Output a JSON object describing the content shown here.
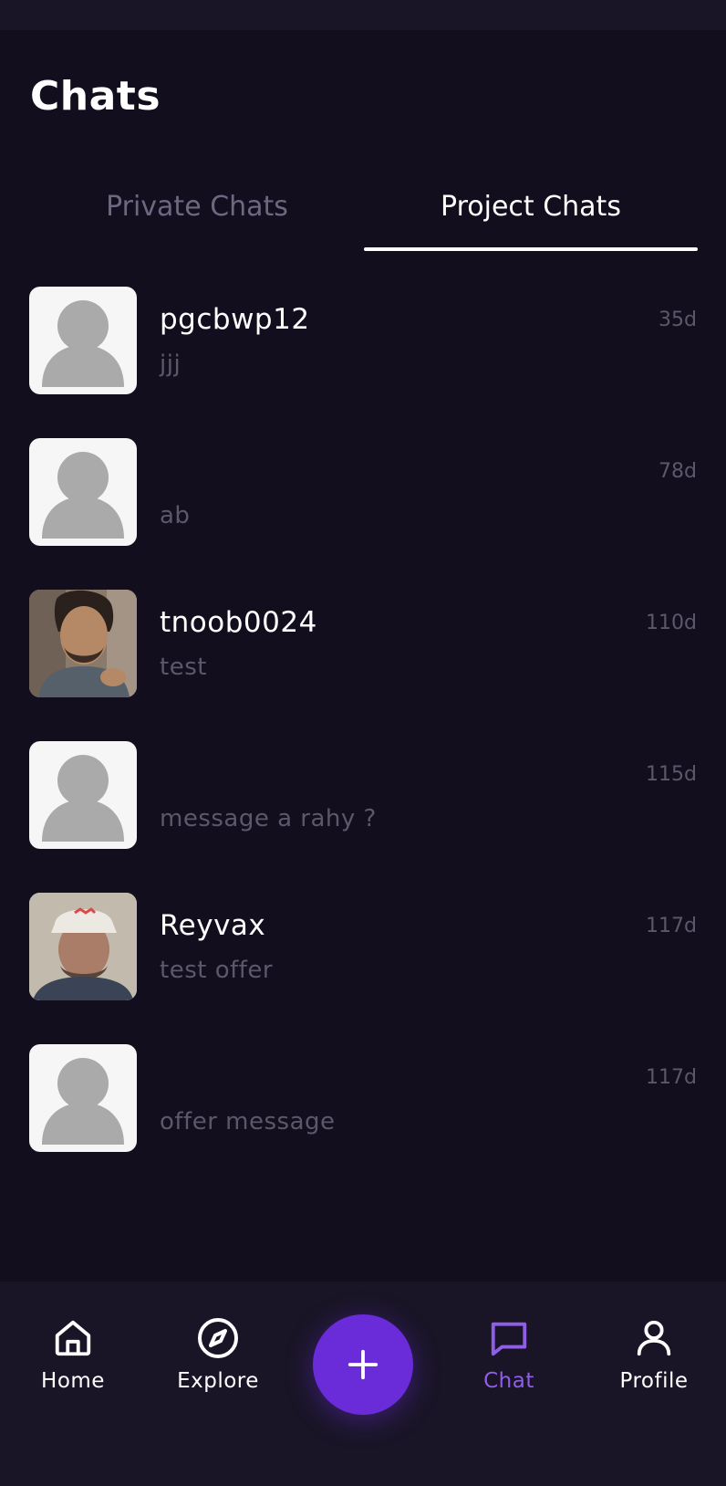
{
  "header": {
    "title": "Chats"
  },
  "tabs": [
    {
      "label": "Private Chats",
      "active": false
    },
    {
      "label": "Project Chats",
      "active": true
    }
  ],
  "chats": [
    {
      "name": "pgcbwp12",
      "preview": "jjj",
      "time": "35d",
      "avatar": "default-avatar-icon"
    },
    {
      "name": "",
      "preview": "ab",
      "time": "78d",
      "avatar": "default-avatar-icon"
    },
    {
      "name": "tnoob0024",
      "preview": "test",
      "time": "110d",
      "avatar": "photo"
    },
    {
      "name": "",
      "preview": "message a rahy ?",
      "time": "115d",
      "avatar": "default-avatar-icon"
    },
    {
      "name": "Reyvax",
      "preview": "test offer",
      "time": "117d",
      "avatar": "photo"
    },
    {
      "name": "",
      "preview": "offer message",
      "time": "117d",
      "avatar": "default-avatar-icon"
    }
  ],
  "nav": {
    "items": [
      {
        "label": "Home",
        "icon": "home-icon",
        "active": false
      },
      {
        "label": "Explore",
        "icon": "compass-icon",
        "active": false
      },
      {
        "label": "Chat",
        "icon": "chat-bubble-icon",
        "active": true
      },
      {
        "label": "Profile",
        "icon": "user-icon",
        "active": false
      }
    ],
    "fab_icon": "plus-icon"
  },
  "colors": {
    "background": "#120e1e",
    "nav_background": "#191526",
    "accent": "#6a2bd9",
    "active_nav": "#8f5ee6",
    "muted_text": "#5c586c"
  }
}
